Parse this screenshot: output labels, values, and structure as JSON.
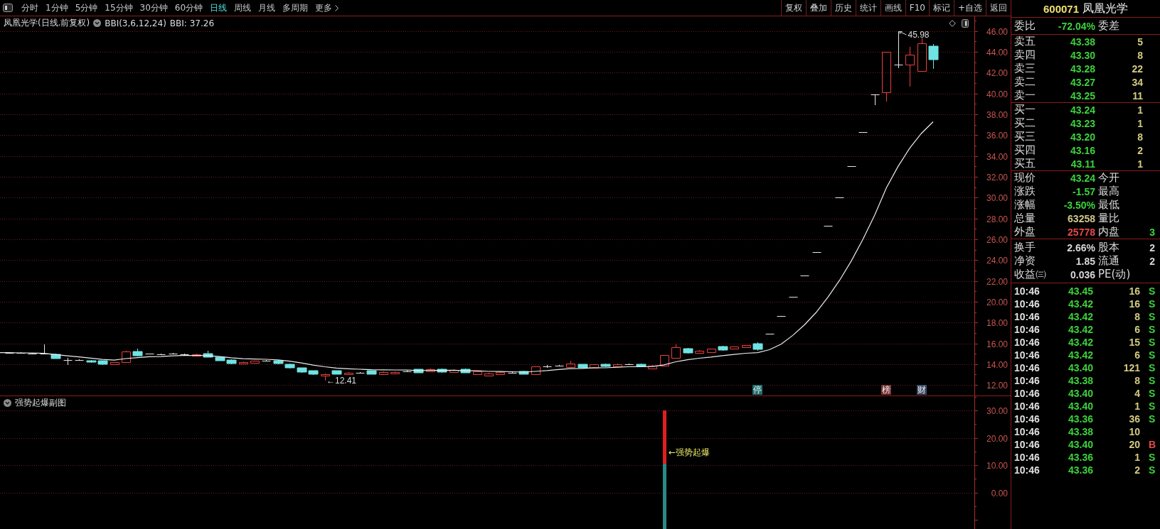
{
  "toolbar": {
    "periods": [
      {
        "label": "分时",
        "kind": "period",
        "selected": false
      },
      {
        "label": "1分钟",
        "kind": "period",
        "selected": false
      },
      {
        "label": "5分钟",
        "kind": "period",
        "selected": false
      },
      {
        "label": "15分钟",
        "kind": "period",
        "selected": false
      },
      {
        "label": "30分钟",
        "kind": "period",
        "selected": false
      },
      {
        "label": "60分钟",
        "kind": "period",
        "selected": false
      },
      {
        "label": "日线",
        "kind": "period",
        "selected": true
      },
      {
        "label": "周线",
        "kind": "period",
        "selected": false
      },
      {
        "label": "月线",
        "kind": "period",
        "selected": false
      },
      {
        "label": "多周期",
        "kind": "period",
        "selected": false
      },
      {
        "label": "更多",
        "kind": "menu",
        "selected": false
      }
    ],
    "actions": [
      "复权",
      "叠加",
      "历史",
      "统计",
      "画线",
      "F10",
      "标记",
      "+自选",
      "返回"
    ]
  },
  "main_chart": {
    "title": "凤凰光学(日线.前复权)",
    "indicator": "BBI(3,6,12,24)",
    "indicator_value": "BBI: 37.26",
    "y_axis": [
      "46.00",
      "44.00",
      "42.00",
      "40.00",
      "38.00",
      "36.00",
      "34.00",
      "32.00",
      "30.00",
      "28.00",
      "26.00",
      "24.00",
      "22.00",
      "20.00",
      "18.00",
      "16.00",
      "14.00",
      "12.00"
    ],
    "high_label": "45.98",
    "low_label": "←12.41",
    "markers": [
      {
        "label": "停",
        "color": "#1f6e6e"
      },
      {
        "label": "榜",
        "color": "#7a3434"
      },
      {
        "label": "财",
        "color": "#3c4a64"
      }
    ]
  },
  "sub_chart": {
    "title": "强势起爆副图",
    "y_axis": [
      "30.00",
      "20.00",
      "10.00",
      "0.00"
    ],
    "signal_label": "←强势起爆"
  },
  "quote": {
    "code": "600071",
    "name": "凤凰光学",
    "order_ratio": {
      "left": {
        "label": "委比",
        "value": "-72.04%",
        "color": "#3cd23c"
      },
      "right": {
        "label": "委差"
      }
    },
    "asks": [
      {
        "label": "卖五",
        "price": "43.38",
        "volume": "5"
      },
      {
        "label": "卖四",
        "price": "43.30",
        "volume": "8"
      },
      {
        "label": "卖三",
        "price": "43.28",
        "volume": "22"
      },
      {
        "label": "卖二",
        "price": "43.27",
        "volume": "34"
      },
      {
        "label": "卖一",
        "price": "43.25",
        "volume": "11"
      }
    ],
    "bids": [
      {
        "label": "买一",
        "price": "43.24",
        "volume": "1"
      },
      {
        "label": "买二",
        "price": "43.23",
        "volume": "1"
      },
      {
        "label": "买三",
        "price": "43.20",
        "volume": "8"
      },
      {
        "label": "买四",
        "price": "43.16",
        "volume": "2"
      },
      {
        "label": "买五",
        "price": "43.11",
        "volume": "1"
      }
    ],
    "stats": [
      {
        "left": {
          "label": "现价",
          "value": "43.24",
          "color": "#3cd23c"
        },
        "right": {
          "label": "今开"
        }
      },
      {
        "left": {
          "label": "涨跌",
          "value": "-1.57",
          "color": "#3cd23c"
        },
        "right": {
          "label": "最高"
        }
      },
      {
        "left": {
          "label": "涨幅",
          "value": "-3.50%",
          "color": "#3cd23c"
        },
        "right": {
          "label": "最低"
        }
      },
      {
        "left": {
          "label": "总量",
          "value": "63258",
          "color": "#d2c88c"
        },
        "right": {
          "label": "量比"
        }
      },
      {
        "left": {
          "label": "外盘",
          "value": "25778",
          "color": "#e84848"
        },
        "right": {
          "label": "内盘",
          "value": "3",
          "color": "#3cd23c"
        }
      }
    ],
    "stats2": [
      {
        "left": {
          "label": "换手",
          "value": "2.66%",
          "color": "#d8d8d8"
        },
        "right": {
          "label": "股本",
          "value": "2",
          "color": "#d8d8d8"
        }
      },
      {
        "left": {
          "label": "净资",
          "value": "1.85",
          "color": "#d8d8d8"
        },
        "right": {
          "label": "流通",
          "value": "2",
          "color": "#d8d8d8"
        }
      },
      {
        "left": {
          "label": "收益㈢",
          "value": "0.036",
          "color": "#d8d8d8"
        },
        "right": {
          "label": "PE(动)"
        }
      }
    ],
    "ticks": [
      {
        "time": "10:46",
        "price": "43.45",
        "volume": "16",
        "flag": "S",
        "color": "#3cd23c"
      },
      {
        "time": "10:46",
        "price": "43.42",
        "volume": "16",
        "flag": "S",
        "color": "#3cd23c"
      },
      {
        "time": "10:46",
        "price": "43.42",
        "volume": "8",
        "flag": "S",
        "color": "#3cd23c"
      },
      {
        "time": "10:46",
        "price": "43.42",
        "volume": "6",
        "flag": "S",
        "color": "#3cd23c"
      },
      {
        "time": "10:46",
        "price": "43.42",
        "volume": "15",
        "flag": "S",
        "color": "#3cd23c"
      },
      {
        "time": "10:46",
        "price": "43.42",
        "volume": "6",
        "flag": "S",
        "color": "#3cd23c"
      },
      {
        "time": "10:46",
        "price": "43.40",
        "volume": "121",
        "flag": "S",
        "color": "#3cd23c"
      },
      {
        "time": "10:46",
        "price": "43.38",
        "volume": "8",
        "flag": "S",
        "color": "#3cd23c"
      },
      {
        "time": "10:46",
        "price": "43.40",
        "volume": "4",
        "flag": "S",
        "color": "#3cd23c"
      },
      {
        "time": "10:46",
        "price": "43.40",
        "volume": "1",
        "flag": "S",
        "color": "#3cd23c"
      },
      {
        "time": "10:46",
        "price": "43.36",
        "volume": "36",
        "flag": "S",
        "color": "#3cd23c"
      },
      {
        "time": "10:46",
        "price": "43.38",
        "volume": "10"
      },
      {
        "time": "10:46",
        "price": "43.40",
        "volume": "20",
        "flag": "B",
        "color": "#e84848"
      },
      {
        "time": "10:46",
        "price": "43.36",
        "volume": "1",
        "flag": "S",
        "color": "#3cd23c"
      },
      {
        "time": "10:46",
        "price": "43.36",
        "volume": "2",
        "flag": "S",
        "color": "#3cd23c"
      }
    ]
  }
}
